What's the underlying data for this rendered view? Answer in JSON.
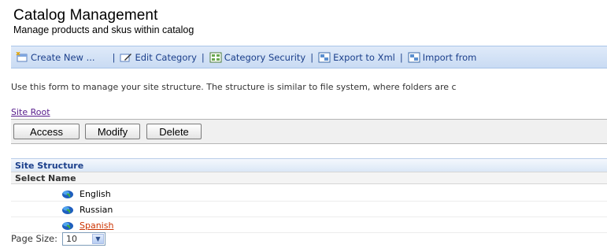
{
  "header": {
    "title": "Catalog Management",
    "subtitle": "Manage products and skus within catalog"
  },
  "toolbar": {
    "items": [
      {
        "label": "Create New ...",
        "icon": "create-new-icon"
      },
      {
        "label": "Edit Category",
        "icon": "edit-icon"
      },
      {
        "label": "Category Security",
        "icon": "security-icon"
      },
      {
        "label": "Export to Xml",
        "icon": "export-icon"
      },
      {
        "label": "Import from",
        "icon": "import-icon"
      }
    ],
    "separator": "|"
  },
  "intro_text": "Use this form to manage your site structure. The structure is similar to file system, where folders are c",
  "breadcrumb": {
    "site_root": "Site Root"
  },
  "actions": {
    "access": "Access",
    "modify": "Modify",
    "delete": "Delete"
  },
  "grid": {
    "title": "Site Structure",
    "columns": {
      "select": "Select",
      "name": "Name"
    },
    "rows": [
      {
        "name": "English",
        "visited": false,
        "icon": "globe-icon"
      },
      {
        "name": "Russian",
        "visited": false,
        "icon": "globe-icon"
      },
      {
        "name": "Spanish",
        "visited": true,
        "icon": "globe-icon"
      }
    ]
  },
  "pager": {
    "label": "Page Size:",
    "value": "10"
  },
  "colors": {
    "toolbar_text": "#1b3f8b",
    "visited_link": "#cc3300",
    "site_root_link": "#551a8b"
  }
}
